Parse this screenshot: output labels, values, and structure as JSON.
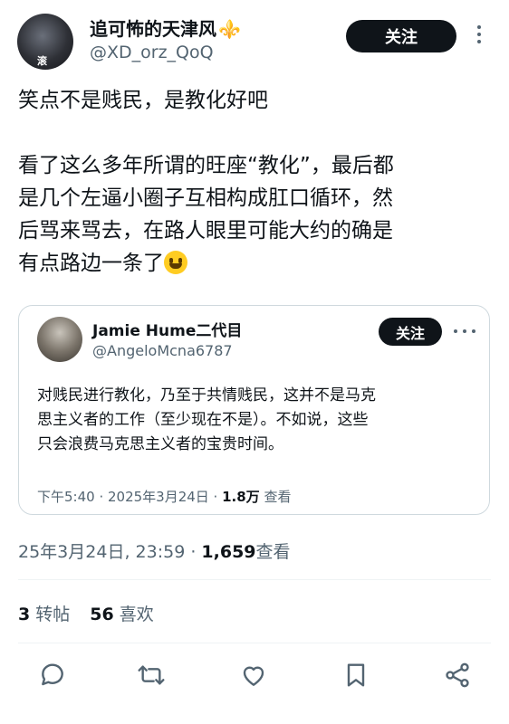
{
  "author": {
    "name": "追可怖的天津风",
    "name_emoji": "⚜️",
    "handle": "@XD_orz_QoQ",
    "avatar_badge": "滚"
  },
  "follow_label": "关注",
  "post": {
    "lines": [
      "笑点不是贱民，是教化好吧",
      "",
      "看了这么多年所谓的旺座“教化”，最后都",
      "是几个左逼小圈子互相构成肛口循环，然",
      "后骂来骂去，在路人眼里可能大约的确是",
      "有点路边一条了"
    ]
  },
  "quote": {
    "name": "Jamie Hume二代目",
    "handle": "@AngeloMcna6787",
    "follow_label": "关注",
    "lines": [
      "对贱民进行教化，乃至于共情贱民，这并不是马克",
      "思主义者的工作（至少现在不是）。不如说，这些",
      "只会浪费马克思主义者的宝贵时间。"
    ],
    "time": "下午5:40 · 2025年3月24日 · ",
    "views_count": "1.8万",
    "views_label": " 查看"
  },
  "timestamp": {
    "time": "25年3月24日, 23:59 · ",
    "views_count": "1,659",
    "views_label": "查看"
  },
  "stats": {
    "reposts_count": "3",
    "reposts_label": "转帖",
    "likes_count": "56",
    "likes_label": "喜欢"
  },
  "actions": [
    "reply-icon",
    "repost-icon",
    "like-icon",
    "bookmark-icon",
    "share-icon"
  ]
}
